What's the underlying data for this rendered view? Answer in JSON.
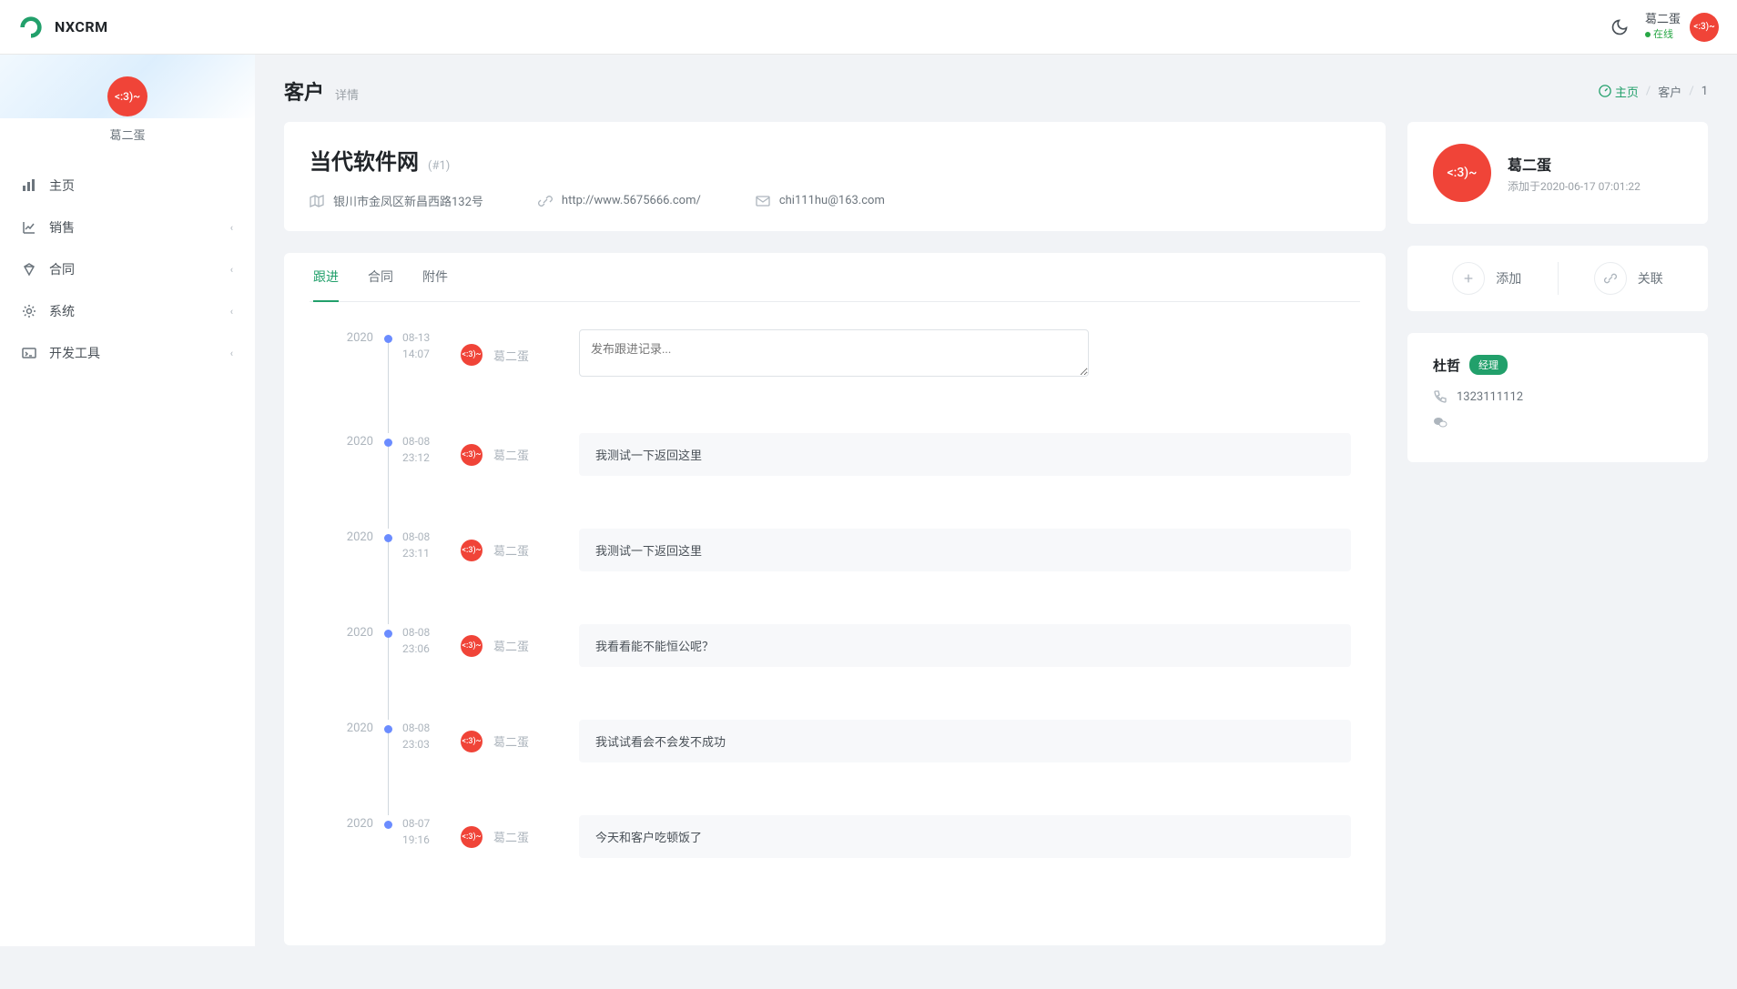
{
  "brand": "NXCRM",
  "header": {
    "username": "葛二蛋",
    "status": "在线",
    "avatar_text": "<:3)~"
  },
  "sidebar": {
    "username": "葛二蛋",
    "avatar_text": "<:3)~",
    "nav": [
      {
        "label": "主页",
        "icon": "home",
        "expandable": false
      },
      {
        "label": "销售",
        "icon": "chart",
        "expandable": true
      },
      {
        "label": "合同",
        "icon": "diamond",
        "expandable": true
      },
      {
        "label": "系统",
        "icon": "gear",
        "expandable": true
      },
      {
        "label": "开发工具",
        "icon": "terminal",
        "expandable": true
      }
    ]
  },
  "page": {
    "title": "客户",
    "subtitle": "详情",
    "breadcrumb": {
      "home": "主页",
      "section": "客户",
      "id": "1"
    }
  },
  "customer": {
    "name": "当代软件网",
    "id": "(#1)",
    "address": "银川市金凤区新昌西路132号",
    "website": "http://www.5675666.com/",
    "email": "chi111hu@163.com"
  },
  "tabs": [
    {
      "label": "跟进",
      "key": "followup",
      "active": true
    },
    {
      "label": "合同",
      "key": "contract",
      "active": false
    },
    {
      "label": "附件",
      "key": "attachment",
      "active": false
    }
  ],
  "timeline": {
    "input_placeholder": "发布跟进记录...",
    "entries": [
      {
        "year": "2020",
        "date": "08-13",
        "time": "14:07",
        "user": "葛二蛋",
        "avatar": "<:3)~",
        "is_input": true
      },
      {
        "year": "2020",
        "date": "08-08",
        "time": "23:12",
        "user": "葛二蛋",
        "avatar": "<:3)~",
        "content": "我测试一下返回这里"
      },
      {
        "year": "2020",
        "date": "08-08",
        "time": "23:11",
        "user": "葛二蛋",
        "avatar": "<:3)~",
        "content": "我测试一下返回这里"
      },
      {
        "year": "2020",
        "date": "08-08",
        "time": "23:06",
        "user": "葛二蛋",
        "avatar": "<:3)~",
        "content": "我看看能不能恒公呢？"
      },
      {
        "year": "2020",
        "date": "08-08",
        "time": "23:03",
        "user": "葛二蛋",
        "avatar": "<:3)~",
        "content": "我试试看会不会发不成功"
      },
      {
        "year": "2020",
        "date": "08-07",
        "time": "19:16",
        "user": "葛二蛋",
        "avatar": "<:3)~",
        "content": "今天和客户吃顿饭了"
      }
    ]
  },
  "owner": {
    "name": "葛二蛋",
    "avatar": "<:3)~",
    "added": "添加于2020-06-17 07:01:22"
  },
  "actions": {
    "add": "添加",
    "link": "关联"
  },
  "contact": {
    "name": "杜哲",
    "role": "经理",
    "phone": "1323111112"
  }
}
